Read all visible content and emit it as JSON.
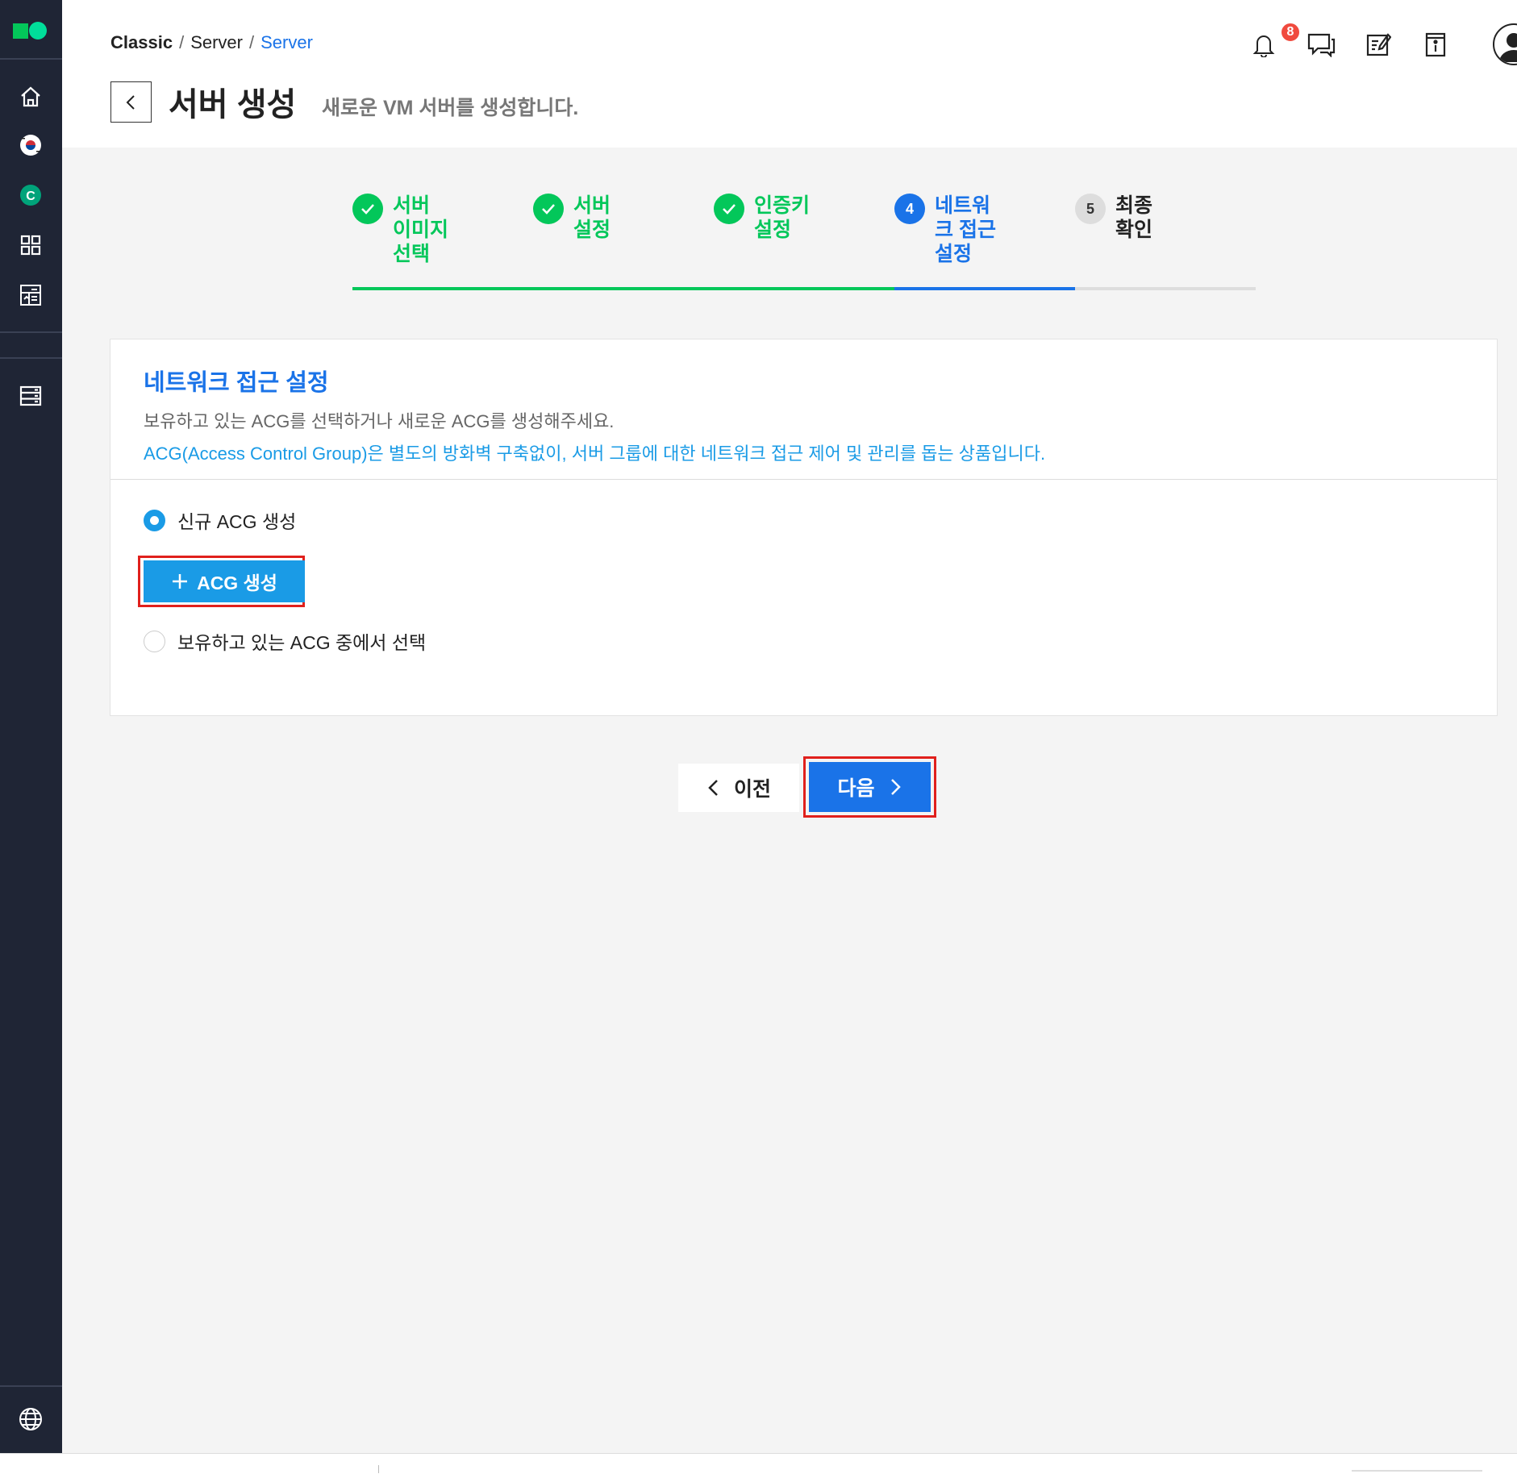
{
  "breadcrumb": [
    "Classic",
    "Server",
    "Server"
  ],
  "header": {
    "title": "서버 생성",
    "subtitle": "새로운 VM 서버를 생성합니다.",
    "notification_count": "8"
  },
  "sidebar": {
    "icons": [
      "home-icon",
      "korea-region-icon",
      "classic-platform-icon",
      "dashboard-grid-icon",
      "report-icon",
      "server-list-icon",
      "globe-icon"
    ],
    "classic_badge": "C"
  },
  "header_icons": [
    "bell-icon",
    "chat-icon",
    "memo-icon",
    "info-book-icon",
    "user-avatar-icon"
  ],
  "steps": [
    {
      "number": "1",
      "label": "서버 이미지 선택",
      "state": "done"
    },
    {
      "number": "2",
      "label": "서버 설정",
      "state": "done"
    },
    {
      "number": "3",
      "label": "인증키 설정",
      "state": "done"
    },
    {
      "number": "4",
      "label": "네트워크 접근 설정",
      "state": "current"
    },
    {
      "number": "5",
      "label": "최종 확인",
      "state": "todo"
    }
  ],
  "section": {
    "title": "네트워크 접근 설정",
    "description": "보유하고 있는 ACG를 선택하거나 새로운 ACG를 생성해주세요.",
    "description_link": "ACG(Access Control Group)은 별도의 방화벽 구축없이, 서버 그룹에 대한 네트워크 접근 제어 및 관리를 돕는 상품입니다."
  },
  "options": {
    "new_acg_label": "신규 ACG 생성",
    "new_acg_selected": true,
    "create_button": "ACG 생성",
    "existing_acg_label": "보유하고 있는 ACG 중에서 선택"
  },
  "nav": {
    "prev": "이전",
    "next": "다음"
  },
  "colors": {
    "sidebar_bg": "#1f2535",
    "brand_green": "#03c75a",
    "primary_blue": "#1a73e8",
    "acg_blue": "#1a9be6",
    "highlight_red": "#e0201c"
  }
}
